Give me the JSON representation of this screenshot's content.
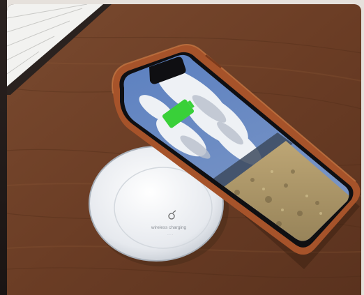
{
  "image": {
    "subject": "smartphone-on-wireless-charger",
    "pad_label": "wireless charging",
    "battery_color": "#39d039",
    "case_color": "#a6532a",
    "wood_color": "#6b3e26"
  }
}
